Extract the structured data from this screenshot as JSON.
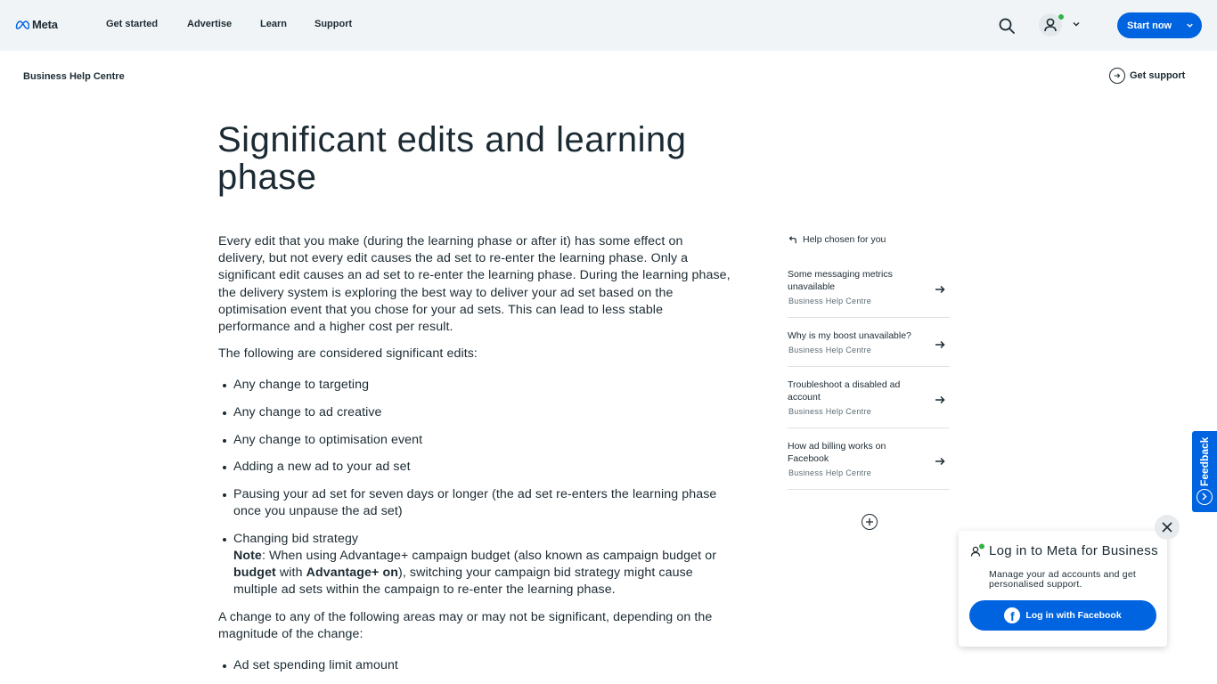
{
  "nav": {
    "logo_text": "Meta",
    "links": [
      "Get started",
      "Advertise",
      "Learn",
      "Support"
    ],
    "start_label": "Start now"
  },
  "header": {
    "breadcrumb": "Business Help Centre",
    "get_support": "Get support"
  },
  "article": {
    "title": "Significant edits and learning phase",
    "intro": "Every edit that you make (during the learning phase or after it) has some effect on delivery, but not every edit causes the ad set to re-enter the learning phase. Only a significant edit causes an ad set to re-enter the learning phase. During the learning phase, the delivery system is exploring the best way to deliver your ad set based on the optimisation event that you chose for your ad sets. This can lead to less stable performance and a higher cost per result.",
    "lead": "The following are considered significant edits:",
    "items": [
      "Any change to targeting",
      "Any change to ad creative",
      "Any change to optimisation event",
      "Adding a new ad to your ad set",
      "Pausing your ad set for seven days or longer (the ad set re-enters the learning phase once you unpause the ad set)"
    ],
    "bid_item": "Changing bid strategy",
    "note": {
      "label": "Note",
      "t1": ": When using Advantage+ campaign budget (also known as campaign budget or ",
      "b1": "budget",
      "t2": " with ",
      "b2": "Advantage+ on",
      "t3": "), switching your campaign bid strategy might cause multiple ad sets within the campaign to re-enter the learning phase."
    },
    "change_intro": "A change to any of the following areas may or may not be significant, depending on the magnitude of the change:",
    "change_items": [
      "Ad set spending limit amount"
    ]
  },
  "rail": {
    "heading": "Help chosen for you",
    "items": [
      {
        "title": "Some messaging metrics unavailable",
        "source": "Business Help Centre"
      },
      {
        "title": "Why is my boost unavailable?",
        "source": "Business Help Centre"
      },
      {
        "title": "Troubleshoot a disabled ad account",
        "source": "Business Help Centre"
      },
      {
        "title": "How ad billing works on Facebook",
        "source": "Business Help Centre"
      }
    ]
  },
  "feedback": {
    "label": "Feedback"
  },
  "login_popup": {
    "title": "Log in to Meta for Business",
    "description": "Manage your ad accounts and get personalised support.",
    "button": "Log in with Facebook"
  },
  "colors": {
    "accent": "#0064e0",
    "nav_bg": "#f1f4f7",
    "text": "#1c2b33",
    "online": "#2fb344"
  }
}
